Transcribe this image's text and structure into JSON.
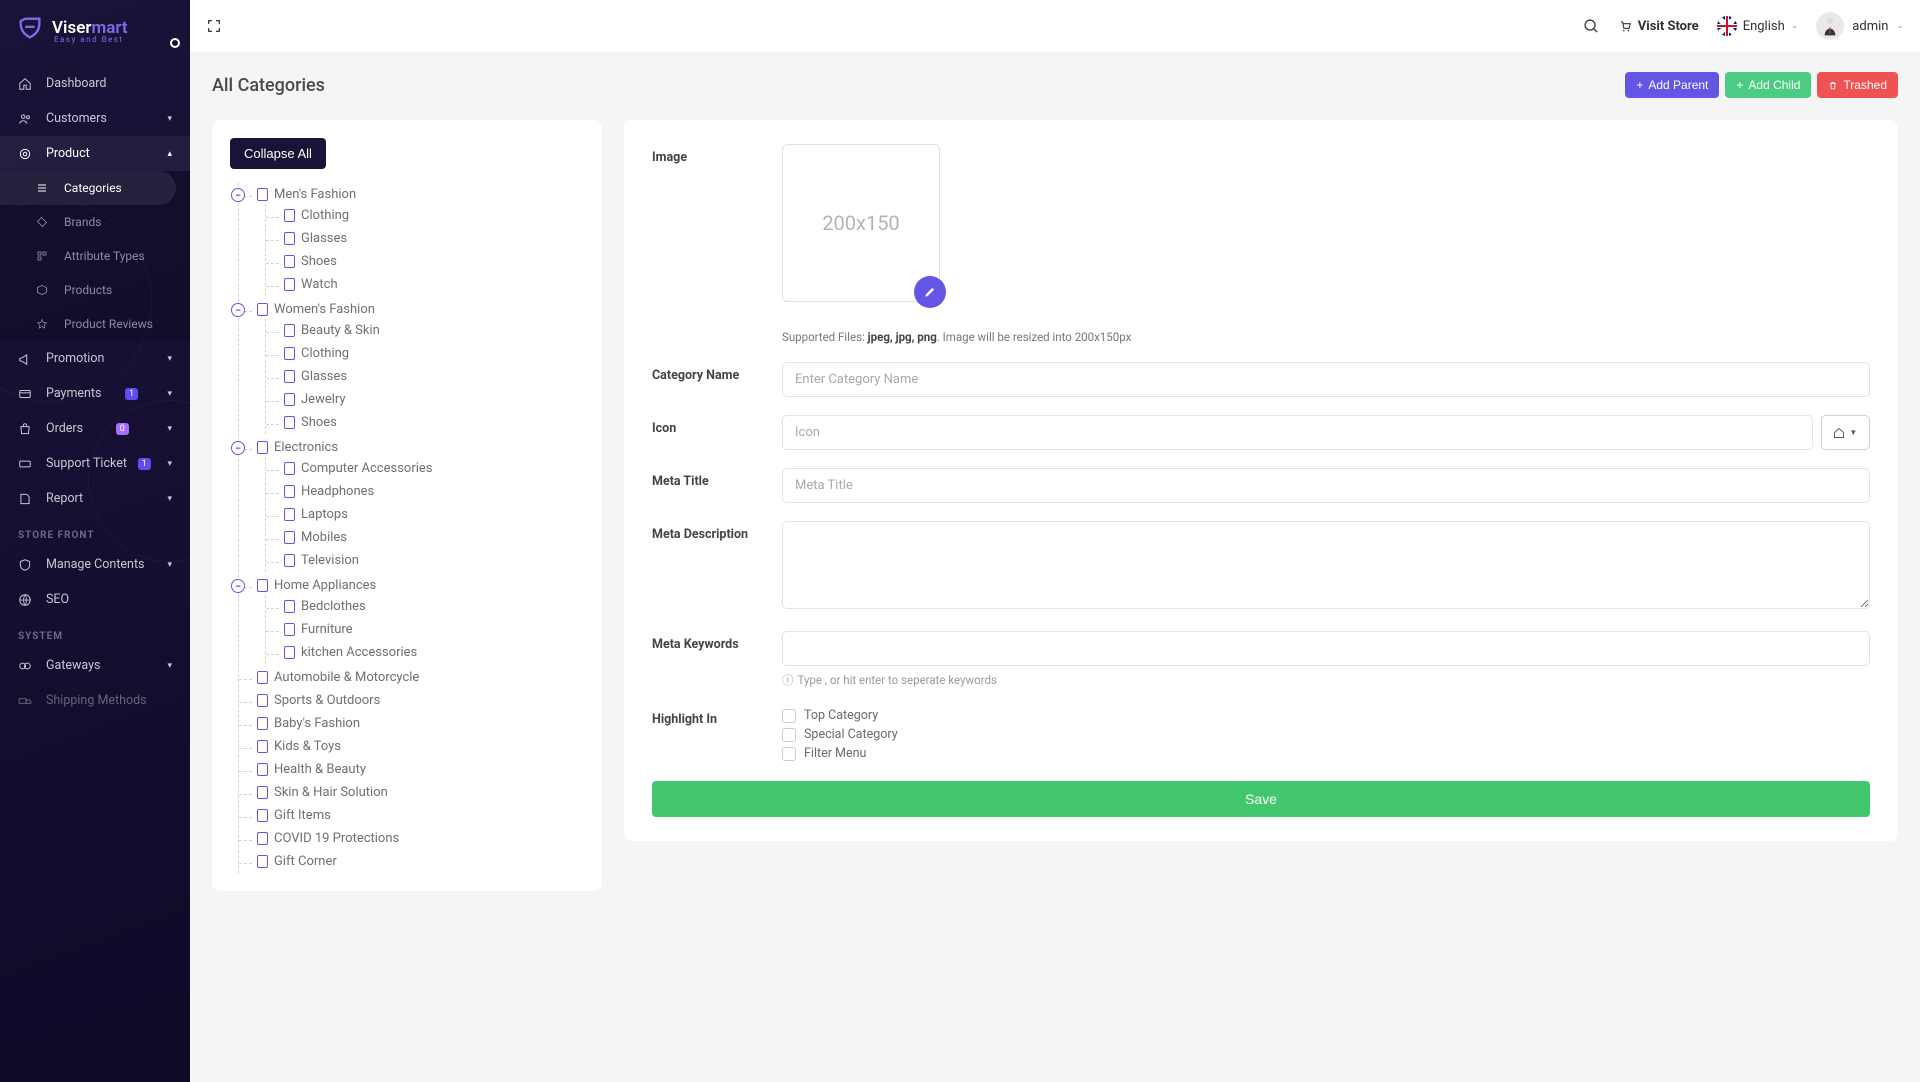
{
  "brand": {
    "v": "Viser",
    "m": "mart",
    "sub": "Easy  and  Best"
  },
  "topbar": {
    "visit": "Visit Store",
    "lang": "English",
    "admin": "admin"
  },
  "sidebar": {
    "items": [
      {
        "label": "Dashboard"
      },
      {
        "label": "Customers"
      },
      {
        "label": "Product"
      },
      {
        "label": "Promotion"
      },
      {
        "label": "Payments"
      },
      {
        "label": "Orders"
      },
      {
        "label": "Support Ticket"
      },
      {
        "label": "Report"
      }
    ],
    "product_sub": [
      {
        "label": "Categories"
      },
      {
        "label": "Brands"
      },
      {
        "label": "Attribute Types"
      },
      {
        "label": "Products"
      },
      {
        "label": "Product Reviews"
      }
    ],
    "section_store": "STORE FRONT",
    "store_items": [
      {
        "label": "Manage Contents"
      },
      {
        "label": "SEO"
      }
    ],
    "section_system": "SYSTEM",
    "system_items": [
      {
        "label": "Gateways"
      },
      {
        "label": "Shipping Methods"
      }
    ],
    "badge_payments": "1",
    "badge_orders": "0",
    "badge_tickets": "1"
  },
  "page": {
    "title": "All Categories",
    "actions": {
      "add_parent": "Add Parent",
      "add_child": "Add Child",
      "trashed": "Trashed"
    },
    "collapse": "Collapse All"
  },
  "tree": [
    {
      "label": "Men's Fashion",
      "children": [
        {
          "label": "Clothing"
        },
        {
          "label": "Glasses"
        },
        {
          "label": "Shoes"
        },
        {
          "label": "Watch"
        }
      ]
    },
    {
      "label": "Women's Fashion",
      "children": [
        {
          "label": "Beauty & Skin"
        },
        {
          "label": "Clothing"
        },
        {
          "label": "Glasses"
        },
        {
          "label": "Jewelry"
        },
        {
          "label": "Shoes"
        }
      ]
    },
    {
      "label": "Electronics",
      "children": [
        {
          "label": "Computer Accessories"
        },
        {
          "label": "Headphones"
        },
        {
          "label": "Laptops"
        },
        {
          "label": "Mobiles"
        },
        {
          "label": "Television"
        }
      ]
    },
    {
      "label": "Home Appliances",
      "children": [
        {
          "label": "Bedclothes"
        },
        {
          "label": "Furniture"
        },
        {
          "label": "kitchen Accessories"
        }
      ]
    },
    {
      "label": "Automobile & Motorcycle"
    },
    {
      "label": "Sports & Outdoors"
    },
    {
      "label": "Baby's Fashion"
    },
    {
      "label": "Kids & Toys"
    },
    {
      "label": "Health & Beauty"
    },
    {
      "label": "Skin & Hair Solution"
    },
    {
      "label": "Gift Items"
    },
    {
      "label": "COVID 19 Protections"
    },
    {
      "label": "Gift Corner"
    }
  ],
  "form": {
    "image_label": "Image",
    "placeholder_img": "200x150",
    "hint1": "Supported Files: ",
    "hint2": "jpeg, jpg, png",
    "hint3": ". Image will be resized into 200x150px",
    "name_label": "Category Name",
    "name_ph": "Enter Category Name",
    "icon_label": "Icon",
    "icon_ph": "Icon",
    "meta_title_label": "Meta Title",
    "meta_title_ph": "Meta Title",
    "meta_desc_label": "Meta Description",
    "meta_kw_label": "Meta Keywords",
    "kw_hint": "Type , or hit enter to seperate keywords",
    "highlight_label": "Highlight In",
    "chk_top": "Top Category",
    "chk_special": "Special Category",
    "chk_filter": "Filter Menu",
    "save": "Save"
  }
}
